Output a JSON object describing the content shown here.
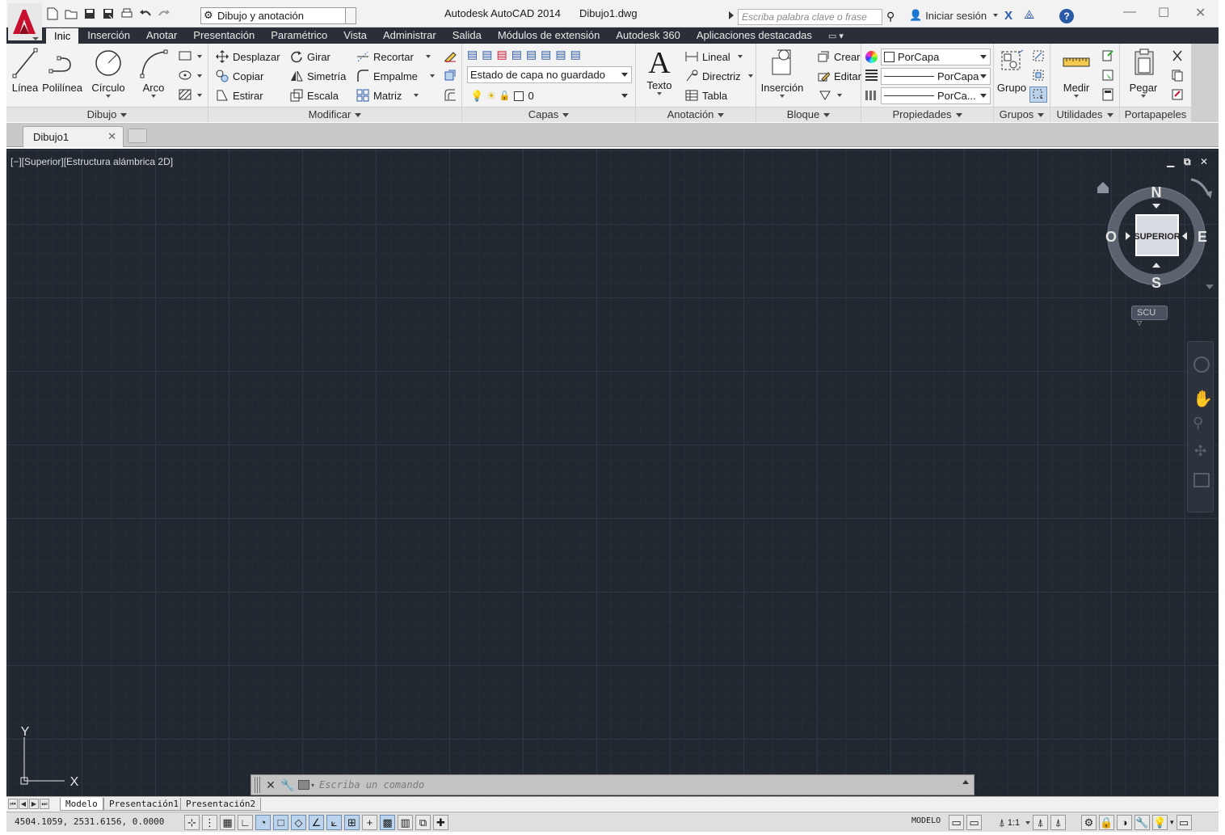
{
  "window": {
    "app_title": "Autodesk AutoCAD 2014",
    "document_title": "Dibujo1.dwg",
    "workspace": "Dibujo y anotación",
    "search_placeholder": "Escriba palabra clave o frase",
    "signin": "Iniciar sesión",
    "minimize": "—",
    "maximize": "☐",
    "close": "✕"
  },
  "ribbon_tabs": [
    "Inic",
    "Inserción",
    "Anotar",
    "Presentación",
    "Paramétrico",
    "Vista",
    "Administrar",
    "Salida",
    "Módulos de extensión",
    "Autodesk 360",
    "Aplicaciones destacadas"
  ],
  "panels": {
    "dibujo": {
      "title": "Dibujo",
      "linea": "Línea",
      "polilinea": "Polilínea",
      "circulo": "Círculo",
      "arco": "Arco"
    },
    "modificar": {
      "title": "Modificar",
      "desplazar": "Desplazar",
      "girar": "Girar",
      "recortar": "Recortar",
      "copiar": "Copiar",
      "simetria": "Simetría",
      "empalme": "Empalme",
      "estirar": "Estirar",
      "escala": "Escala",
      "matriz": "Matriz"
    },
    "capas": {
      "title": "Capas",
      "state": "Estado de capa no guardado",
      "layer": "0"
    },
    "anotacion": {
      "title": "Anotación",
      "texto": "Texto",
      "lineal": "Lineal",
      "directriz": "Directriz",
      "tabla": "Tabla"
    },
    "bloque": {
      "title": "Bloque",
      "insercion": "Inserción",
      "crear": "Crear",
      "editar": "Editar"
    },
    "propiedades": {
      "title": "Propiedades",
      "color": "PorCapa",
      "linetype": "PorCapa",
      "lineweight": "PorCa..."
    },
    "grupos": {
      "title": "Grupos",
      "grupo": "Grupo"
    },
    "utilidades": {
      "title": "Utilidades",
      "medir": "Medir"
    },
    "portapapeles": {
      "title": "Portapapeles",
      "pegar": "Pegar"
    }
  },
  "doc_tab": "Dibujo1",
  "viewport": {
    "label": "[−][Superior][Estructura alámbrica 2D]",
    "viewcube": {
      "face": "SUPERIOR",
      "n": "N",
      "s": "S",
      "e": "E",
      "w": "O"
    },
    "ucs_menu": "SCU",
    "ucs_x": "X",
    "ucs_y": "Y"
  },
  "command_line": {
    "placeholder": "Escriba un comando"
  },
  "layout_tabs": [
    "Modelo",
    "Presentación1",
    "Presentación2"
  ],
  "status": {
    "coords": "4504.1059, 2531.6156, 0.0000",
    "space": "MODELO",
    "scale": "1:1"
  }
}
